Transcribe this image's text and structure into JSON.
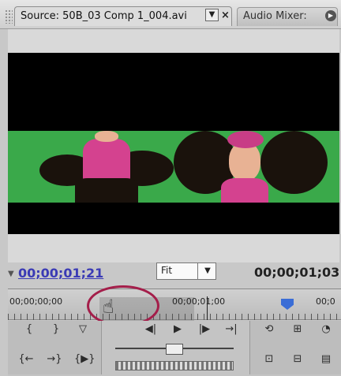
{
  "tabs": {
    "source_label": "Source: 50B_03 Comp 1_004.avi",
    "menu_glyph": "▼",
    "close_glyph": "×",
    "audio_label": "Audio Mixer:"
  },
  "timecode": {
    "current": "00;00;01;21",
    "duration": "00;00;01;03"
  },
  "zoom": {
    "selected": "Fit",
    "dropdown_glyph": "▼"
  },
  "ruler": {
    "label_start": "00;00;00;00",
    "label_mid": "00;00;01;00",
    "label_end": "00;0"
  },
  "icons": {
    "hand": "☝",
    "mark_in": "{",
    "mark_out": "}",
    "set_marker": "▽",
    "goto_in": "{←",
    "goto_out": "→}",
    "play_in_out": "{▶}",
    "step_back": "◀|",
    "play": "▶",
    "step_forward": "|▶",
    "goto_next": "→|",
    "loop": "⟲",
    "safe_margins": "⊞",
    "output": "◔",
    "insert": "⊡",
    "overlay": "⊟",
    "export_frame": "▤"
  }
}
